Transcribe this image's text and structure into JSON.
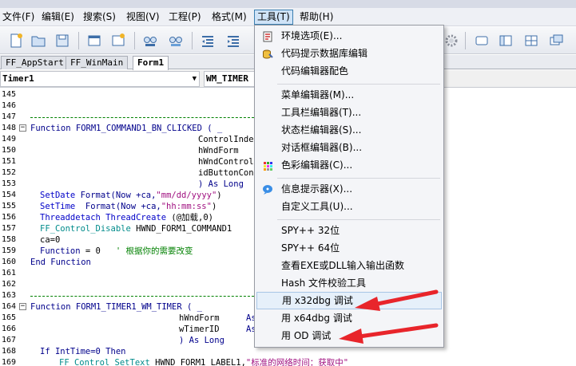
{
  "menubar": {
    "items": [
      "文件(F)",
      "编辑(E)",
      "搜索(S)",
      "视图(V)",
      "工程(P)",
      "格式(M)",
      "工具(T)",
      "帮助(H)"
    ],
    "active_index": 6
  },
  "tabs": [
    "FF_AppStart",
    "FF_WinMain",
    "Form1"
  ],
  "selected_tab": 2,
  "combos": {
    "object": "Timer1",
    "event": "WM_TIMER"
  },
  "editor": {
    "line_numbers": [
      "145",
      "146",
      "147",
      "148",
      "149",
      "150",
      "151",
      "152",
      "153",
      "154",
      "155",
      "156",
      "157",
      "158",
      "159",
      "160",
      "161",
      "162",
      "163",
      "164",
      "165",
      "166",
      "167",
      "168",
      "169"
    ],
    "code": {
      "l148": "Function FORM1_COMMAND1_BN_CLICKED ( _",
      "l149": "ControlIndex",
      "l150": "hWndForm",
      "l151": "hWndControl",
      "l152": "idButtonCont",
      "l153": ") As Long",
      "l154a": "SetDate",
      "l154b": " Format(Now +ca,",
      "l154c": "\"mm/dd/yyyy\"",
      "l154d": ")",
      "l155a": "SetTime",
      "l155b": "  Format(Now +ca,",
      "l155c": "\"hh:mm:ss\"",
      "l155d": ")",
      "l156a": "Threaddetach ThreadCreate",
      "l156b": " (@加载,0)",
      "l157a": "FF_Control_Disable",
      "l157b": " HWND_FORM1_COMMAND1",
      "l158": "ca=0",
      "l159a": "Function",
      "l159b": " = 0   ",
      "l159c": "' 根据你的需要改变",
      "l160": "End Function",
      "l164": "Function FORM1_TIMER1_WM_TIMER ( _",
      "l165a": "hWndForm",
      "l165b": "As",
      "l166a": "wTimerID",
      "l166b": "As",
      "l167": ") As Long",
      "l168": "If IntTime=0 Then",
      "l169a": "FF_Control_SetText",
      "l169b": " HWND_FORM1_LABEL1,",
      "l169c": "\"标准的网络时间：获取中\""
    }
  },
  "tools_menu": {
    "items": [
      {
        "label": "环境选项(E)...",
        "icon": "environment-options-icon"
      },
      {
        "label": "代码提示数据库编辑",
        "icon": "code-hint-database-icon"
      },
      {
        "label": "代码编辑器配色",
        "icon": ""
      },
      {
        "label": "菜单编辑器(M)...",
        "icon": ""
      },
      {
        "label": "工具栏编辑器(T)...",
        "icon": ""
      },
      {
        "label": "状态栏编辑器(S)...",
        "icon": ""
      },
      {
        "label": "对话框编辑器(B)...",
        "icon": ""
      },
      {
        "label": "色彩编辑器(C)...",
        "icon": "color-palette-icon"
      },
      {
        "label": "信息提示器(X)...",
        "icon": "info-bubble-icon"
      },
      {
        "label": "自定义工具(U)...",
        "icon": ""
      },
      {
        "label": "SPY++ 32位",
        "icon": ""
      },
      {
        "label": "SPY++ 64位",
        "icon": ""
      },
      {
        "label": "查看EXE或DLL输入输出函数",
        "icon": ""
      },
      {
        "label": "Hash 文件校验工具",
        "icon": ""
      },
      {
        "label": "用 x32dbg 调试",
        "icon": ""
      },
      {
        "label": "用 x64dbg 调试",
        "icon": ""
      },
      {
        "label": "用 OD 调试",
        "icon": ""
      }
    ],
    "highlighted_index": 14
  },
  "colors": {
    "annotation_arrow": "#e8252b",
    "menu_highlight": "#e6f0fa",
    "keyword": "#00008b",
    "string": "#a01080",
    "comment": "#008000"
  }
}
